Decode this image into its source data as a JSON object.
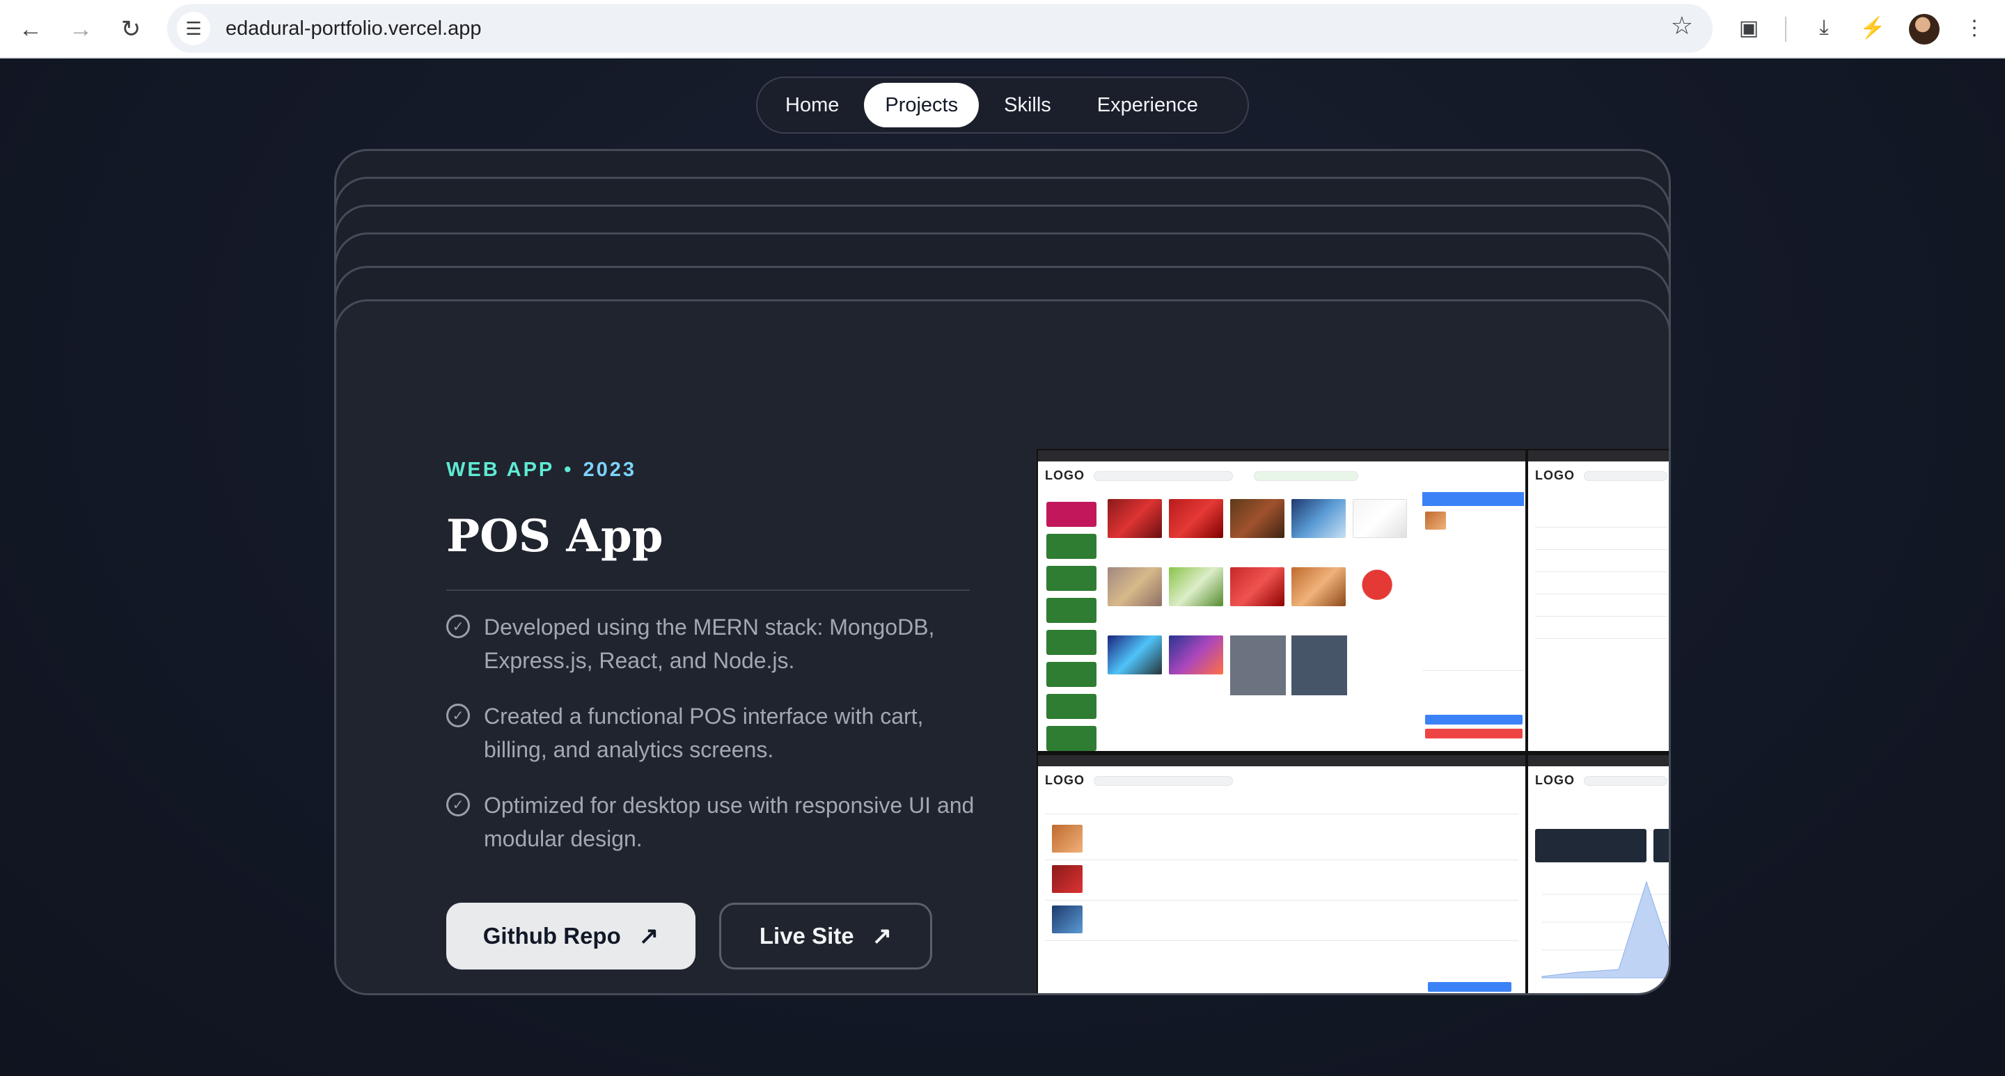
{
  "browser": {
    "url": "edadural-portfolio.vercel.app",
    "icons": [
      "back-arrow-icon",
      "forward-arrow-icon",
      "reload-icon",
      "site-settings-icon",
      "bookmark-star-icon",
      "extensions-icon",
      "download-icon",
      "performance-icon",
      "profile-avatar",
      "more-menu-icon"
    ]
  },
  "nav": {
    "items": [
      "Home",
      "Projects",
      "Skills",
      "Experience"
    ],
    "active": "Projects"
  },
  "project": {
    "tag": "WEB APP",
    "separator": "•",
    "year": "2023",
    "title": "POS App",
    "bullets": [
      "Developed using the MERN stack: MongoDB, Express.js, React, and Node.js.",
      "Created a functional POS interface with cart, billing, and analytics screens.",
      "Optimized for desktop use with responsive UI and modular design."
    ],
    "buttons": {
      "github": "Github Repo",
      "live": "Live Site"
    }
  },
  "preview": {
    "logo": "LOGO",
    "colors": {
      "category_active": "#c2185b",
      "category": "#2e7d32",
      "accent_blue": "#3b82f6",
      "danger": "#ef4444"
    }
  }
}
